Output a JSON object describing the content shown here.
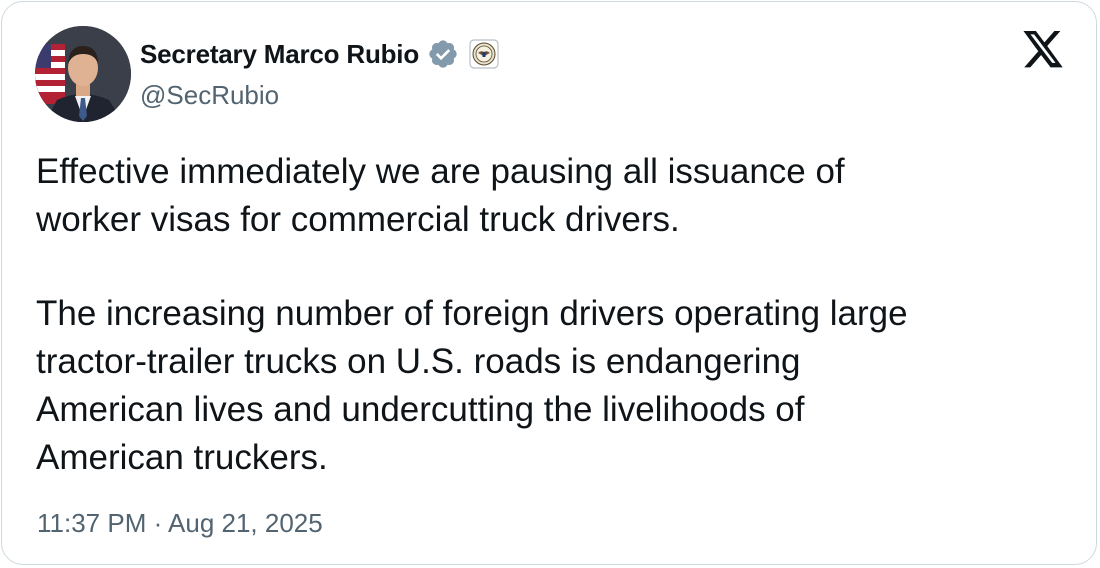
{
  "author": {
    "display_name": "Secretary Marco Rubio",
    "handle": "@SecRubio",
    "verified_badge": "verified-badge-gray-icon",
    "affiliation_badge": "state-department-seal-icon"
  },
  "tweet": {
    "paragraphs": [
      [
        "Effective immediately we are pausing all issuance of",
        "worker visas for commercial truck drivers."
      ],
      [
        "The increasing number of foreign drivers operating large",
        "tractor-trailer trucks on U.S. roads is endangering",
        "American lives and undercutting the livelihoods of",
        "American truckers."
      ]
    ],
    "timestamp": "11:37 PM · Aug 21, 2025"
  },
  "platform": {
    "logo": "x-logo-icon"
  },
  "colors": {
    "text_primary": "#0f1419",
    "text_secondary": "#536471",
    "border": "#cfd9de",
    "badge_gray": "#829aab"
  }
}
